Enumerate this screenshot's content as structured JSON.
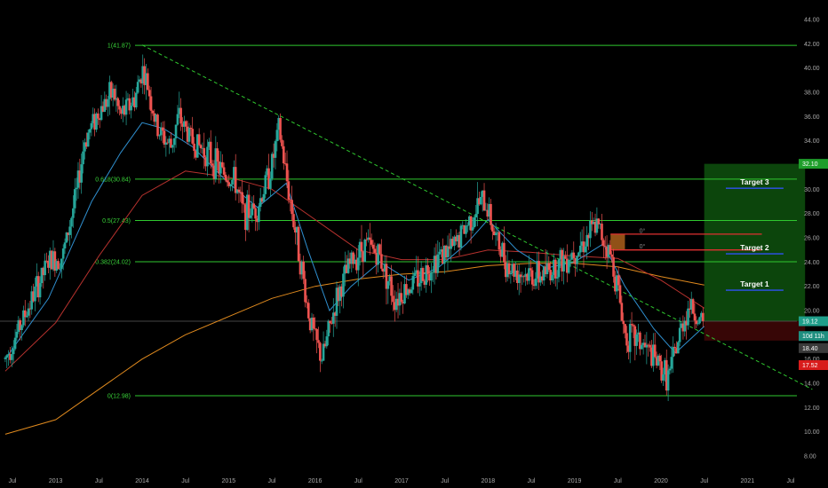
{
  "chart_data": {
    "type": "candlestick",
    "colors": {
      "background": "#000000",
      "up": "#26a69a",
      "down": "#ef5350",
      "fib_line": "#2fc82f",
      "trendline": "#2fc82f",
      "ema_fast": "#2f8fcf",
      "ema_mid": "#b8322e",
      "ema_slow": "#e08a1e",
      "target_zone": "#0d4d0d",
      "stop_zone": "#3a0606"
    },
    "y_axis": {
      "position": "right",
      "range": [
        7,
        45
      ],
      "ticks": [
        "44.00",
        "42.00",
        "40.00",
        "38.00",
        "36.00",
        "34.00",
        "32.00",
        "30.00",
        "28.00",
        "26.00",
        "24.00",
        "22.00",
        "20.00",
        "18.00",
        "16.00",
        "14.00",
        "12.00",
        "10.00",
        "8.00"
      ]
    },
    "x_axis": {
      "range": [
        "2012-06",
        "2021-09"
      ],
      "ticks": [
        {
          "label": "Jul",
          "date": "2012-07"
        },
        {
          "label": "2013",
          "date": "2013-01"
        },
        {
          "label": "Jul",
          "date": "2013-07"
        },
        {
          "label": "2014",
          "date": "2014-01"
        },
        {
          "label": "Jul",
          "date": "2014-07"
        },
        {
          "label": "2015",
          "date": "2015-01"
        },
        {
          "label": "Jul",
          "date": "2015-07"
        },
        {
          "label": "2016",
          "date": "2016-01"
        },
        {
          "label": "Jul",
          "date": "2016-07"
        },
        {
          "label": "2017",
          "date": "2017-01"
        },
        {
          "label": "Jul",
          "date": "2017-07"
        },
        {
          "label": "2018",
          "date": "2018-01"
        },
        {
          "label": "Jul",
          "date": "2018-07"
        },
        {
          "label": "2019",
          "date": "2019-01"
        },
        {
          "label": "Jul",
          "date": "2019-07"
        },
        {
          "label": "2020",
          "date": "2020-01"
        },
        {
          "label": "Jul",
          "date": "2020-07"
        },
        {
          "label": "2021",
          "date": "2021-01"
        },
        {
          "label": "Jul",
          "date": "2021-07"
        }
      ]
    },
    "fib_levels": [
      {
        "label": "1(41.87)",
        "value": 41.87
      },
      {
        "label": "0.618(30.84)",
        "value": 30.84
      },
      {
        "label": "0.5(27.43)",
        "value": 27.43
      },
      {
        "label": "0.382(24.02)",
        "value": 24.02
      },
      {
        "label": "0(12.98)",
        "value": 12.98
      }
    ],
    "price_path": [
      [
        "2012-06",
        16.0
      ],
      [
        "2012-09",
        20.0
      ],
      [
        "2012-12",
        24.0
      ],
      [
        "2013-02",
        24.5
      ],
      [
        "2013-04",
        30.0
      ],
      [
        "2013-05",
        34.0
      ],
      [
        "2013-07",
        36.5
      ],
      [
        "2013-09",
        38.0
      ],
      [
        "2013-10",
        36.0
      ],
      [
        "2013-12",
        37.5
      ],
      [
        "2014-01",
        40.0
      ],
      [
        "2014-02",
        38.0
      ],
      [
        "2014-03",
        35.0
      ],
      [
        "2014-05",
        33.5
      ],
      [
        "2014-06",
        36.0
      ],
      [
        "2014-08",
        34.0
      ],
      [
        "2014-10",
        33.0
      ],
      [
        "2014-12",
        31.5
      ],
      [
        "2015-02",
        30.5
      ],
      [
        "2015-03",
        28.0
      ],
      [
        "2015-05",
        28.5
      ],
      [
        "2015-07",
        32.0
      ],
      [
        "2015-08",
        35.0
      ],
      [
        "2015-09",
        31.0
      ],
      [
        "2015-10",
        27.5
      ],
      [
        "2015-11",
        24.0
      ],
      [
        "2015-12",
        20.0
      ],
      [
        "2016-01",
        17.5
      ],
      [
        "2016-02",
        16.0
      ],
      [
        "2016-04",
        21.0
      ],
      [
        "2016-06",
        24.0
      ],
      [
        "2016-08",
        25.5
      ],
      [
        "2016-10",
        24.5
      ],
      [
        "2016-12",
        21.0
      ],
      [
        "2017-02",
        22.0
      ],
      [
        "2017-04",
        23.0
      ],
      [
        "2017-06",
        24.5
      ],
      [
        "2017-08",
        25.0
      ],
      [
        "2017-10",
        27.0
      ],
      [
        "2017-12",
        29.0
      ],
      [
        "2018-01",
        28.5
      ],
      [
        "2018-02",
        26.0
      ],
      [
        "2018-04",
        23.5
      ],
      [
        "2018-06",
        23.0
      ],
      [
        "2018-08",
        22.8
      ],
      [
        "2018-10",
        23.5
      ],
      [
        "2018-12",
        24.5
      ],
      [
        "2019-02",
        25.5
      ],
      [
        "2019-04",
        27.0
      ],
      [
        "2019-05",
        26.0
      ],
      [
        "2019-06",
        24.5
      ],
      [
        "2019-07",
        22.0
      ],
      [
        "2019-08",
        18.0
      ],
      [
        "2019-10",
        17.5
      ],
      [
        "2019-12",
        16.0
      ],
      [
        "2020-02",
        14.5
      ],
      [
        "2020-03",
        16.5
      ],
      [
        "2020-04",
        19.0
      ],
      [
        "2020-05",
        20.5
      ],
      [
        "2020-06",
        19.5
      ],
      [
        "2020-07",
        18.4
      ]
    ],
    "ema_fast": [
      [
        "2012-06",
        16.0
      ],
      [
        "2012-12",
        21.0
      ],
      [
        "2013-06",
        29.0
      ],
      [
        "2013-10",
        33.0
      ],
      [
        "2014-01",
        35.5
      ],
      [
        "2014-04",
        35.0
      ],
      [
        "2014-08",
        33.5
      ],
      [
        "2015-01",
        30.5
      ],
      [
        "2015-05",
        28.5
      ],
      [
        "2015-09",
        30.5
      ],
      [
        "2015-12",
        25.0
      ],
      [
        "2016-03",
        20.0
      ],
      [
        "2016-06",
        22.0
      ],
      [
        "2016-10",
        24.0
      ],
      [
        "2017-02",
        22.5
      ],
      [
        "2017-06",
        23.5
      ],
      [
        "2017-10",
        25.5
      ],
      [
        "2018-01",
        27.5
      ],
      [
        "2018-05",
        25.0
      ],
      [
        "2018-09",
        23.5
      ],
      [
        "2019-01",
        24.0
      ],
      [
        "2019-05",
        25.5
      ],
      [
        "2019-08",
        22.0
      ],
      [
        "2019-12",
        18.5
      ],
      [
        "2020-03",
        16.5
      ],
      [
        "2020-07",
        18.7
      ]
    ],
    "ema_mid": [
      [
        "2012-06",
        15.0
      ],
      [
        "2013-01",
        19.0
      ],
      [
        "2013-07",
        24.5
      ],
      [
        "2014-01",
        29.5
      ],
      [
        "2014-07",
        31.5
      ],
      [
        "2015-01",
        31.0
      ],
      [
        "2015-07",
        30.0
      ],
      [
        "2016-01",
        27.5
      ],
      [
        "2016-07",
        25.0
      ],
      [
        "2017-01",
        24.2
      ],
      [
        "2017-07",
        24.2
      ],
      [
        "2018-01",
        25.0
      ],
      [
        "2018-07",
        24.8
      ],
      [
        "2019-01",
        24.5
      ],
      [
        "2019-07",
        24.3
      ],
      [
        "2020-01",
        22.5
      ],
      [
        "2020-07",
        20.2
      ]
    ],
    "ema_slow": [
      [
        "2012-06",
        9.8
      ],
      [
        "2013-01",
        11.0
      ],
      [
        "2013-07",
        13.5
      ],
      [
        "2014-01",
        16.0
      ],
      [
        "2014-07",
        18.0
      ],
      [
        "2015-01",
        19.5
      ],
      [
        "2015-07",
        21.0
      ],
      [
        "2016-01",
        22.0
      ],
      [
        "2016-07",
        22.6
      ],
      [
        "2017-01",
        23.0
      ],
      [
        "2017-07",
        23.2
      ],
      [
        "2018-01",
        23.7
      ],
      [
        "2018-07",
        23.9
      ],
      [
        "2019-01",
        23.9
      ],
      [
        "2019-07",
        23.6
      ],
      [
        "2020-01",
        22.8
      ],
      [
        "2020-07",
        22.1
      ]
    ],
    "trendline": {
      "from": [
        "2014-01",
        41.9
      ],
      "to": [
        "2021-10",
        13.5
      ]
    },
    "current_price_line": 19.12,
    "target_zone": {
      "from": "2020-07",
      "to": "2021-09",
      "top": 32.1,
      "bottom": 19.12
    },
    "stop_zone": {
      "from": "2020-07",
      "to": "2021-09",
      "top": 19.12,
      "bottom": 17.52
    },
    "targets": [
      {
        "label": "Target 1",
        "value": 21.9
      },
      {
        "label": "Target 2",
        "value": 24.9
      },
      {
        "label": "Target 3",
        "value": 30.3
      }
    ],
    "red_levels": [
      {
        "value": 26.3,
        "from": "2019-06",
        "to": "2021-03",
        "marker": "0°"
      },
      {
        "value": 25.0,
        "from": "2019-06",
        "to": "2021-03",
        "marker": "0°"
      }
    ],
    "orange_box": {
      "from": "2019-06",
      "to": "2019-08",
      "top": 26.3,
      "bottom": 25.0
    },
    "price_tags": [
      {
        "text": "32.10",
        "value": 32.1,
        "color": "#1f9e2b"
      },
      {
        "text": "19.12",
        "value": 19.12,
        "color": "#1f9e8a"
      },
      {
        "text": "10d 11h",
        "value": 17.9,
        "color": "#1f8f80"
      },
      {
        "text": "18.40",
        "value": 16.9,
        "color": "#3a3a3a"
      },
      {
        "text": "17.52",
        "value": 15.5,
        "color": "#d81b1b"
      }
    ]
  }
}
